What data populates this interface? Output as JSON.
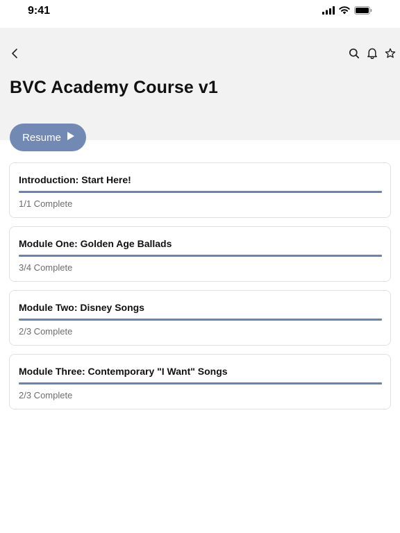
{
  "status_bar": {
    "time": "9:41",
    "icons": [
      "signal-icon",
      "wifi-icon",
      "battery-icon"
    ]
  },
  "header": {
    "title": "BVC Academy Course v1",
    "back_icon": "chevron-left-icon",
    "actions": [
      "search-icon",
      "bell-icon",
      "star-icon"
    ]
  },
  "resume_button": {
    "label": "Resume",
    "icon": "play-icon",
    "color": "#7289b3"
  },
  "modules": [
    {
      "title": "Introduction: Start Here!",
      "status": "1/1 Complete",
      "progress": 1.0
    },
    {
      "title": "Module One: Golden Age Ballads",
      "status": "3/4 Complete",
      "progress": 1.0
    },
    {
      "title": "Module Two: Disney Songs",
      "status": "2/3 Complete",
      "progress": 1.0
    },
    {
      "title": "Module Three: Contemporary \"I Want\" Songs",
      "status": "2/3 Complete",
      "progress": 1.0
    }
  ],
  "colors": {
    "accent": "#6a83b0",
    "header_bg": "#f2f2f2"
  }
}
